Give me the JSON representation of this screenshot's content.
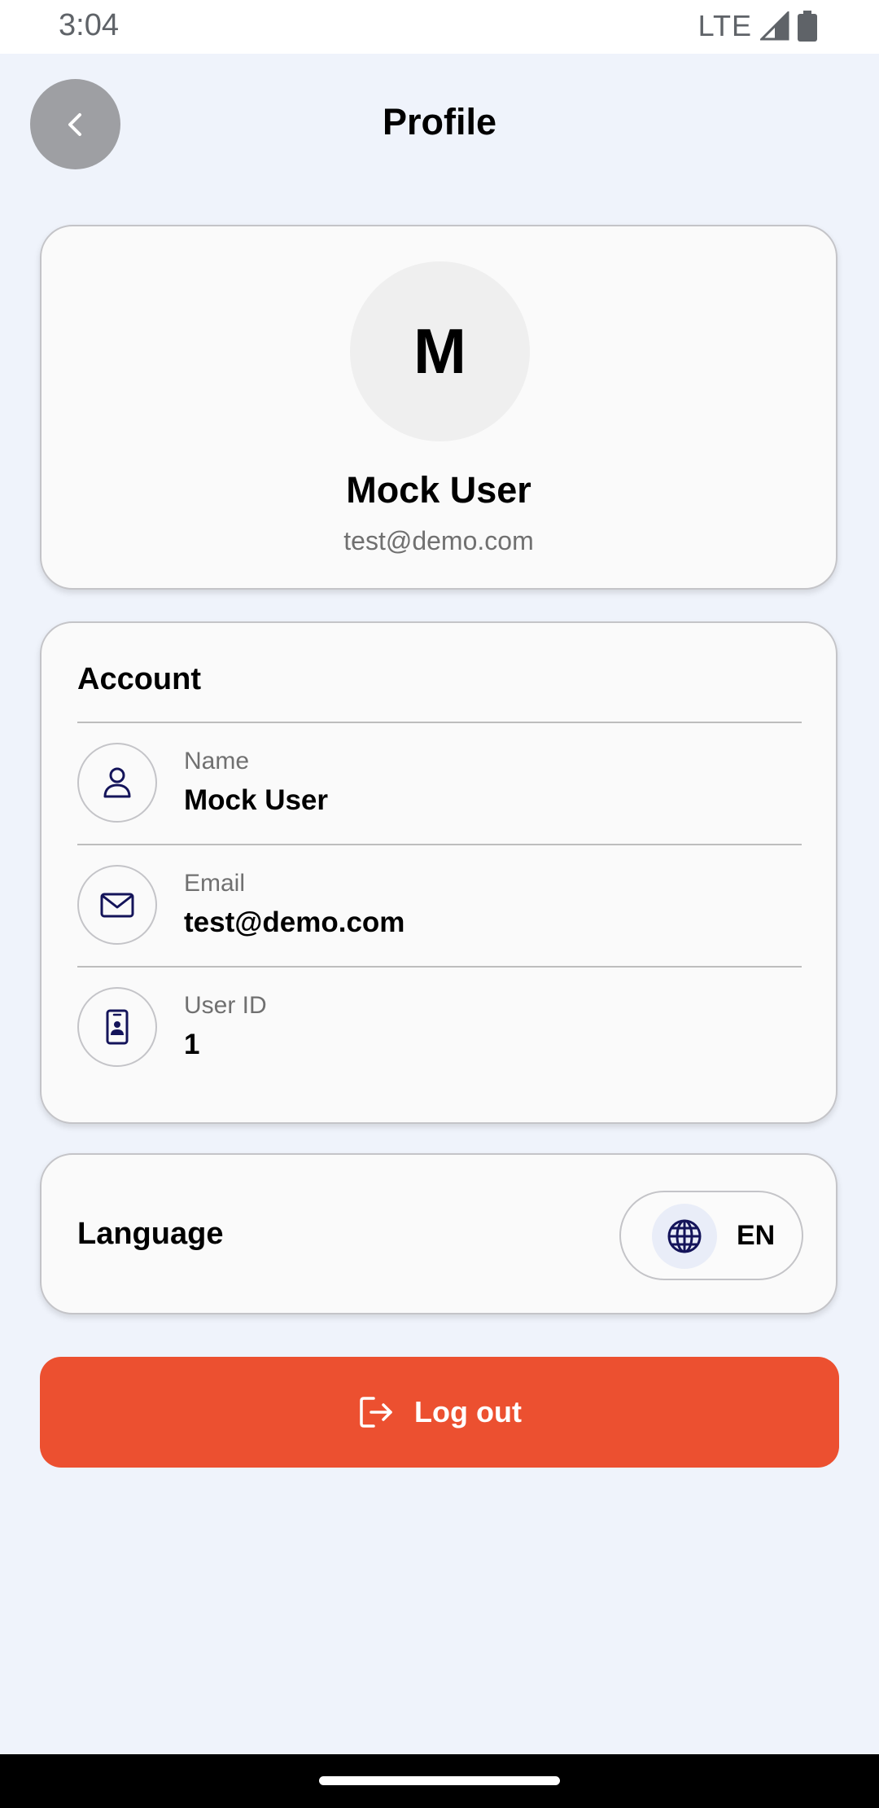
{
  "status_bar": {
    "time": "3:04",
    "network": "LTE",
    "icons": [
      "signal-icon",
      "battery-icon"
    ]
  },
  "header": {
    "title": "Profile",
    "back_icon": "chevron-left-icon"
  },
  "profile": {
    "avatar_initial": "M",
    "name": "Mock User",
    "email": "test@demo.com"
  },
  "account": {
    "title": "Account",
    "rows": [
      {
        "icon": "user-icon",
        "label": "Name",
        "value": "Mock User"
      },
      {
        "icon": "mail-icon",
        "label": "Email",
        "value": "test@demo.com"
      },
      {
        "icon": "id-badge-icon",
        "label": "User ID",
        "value": "1"
      }
    ]
  },
  "language": {
    "label": "Language",
    "current": "EN",
    "icon": "globe-icon"
  },
  "logout": {
    "label": "Log out",
    "icon": "logout-icon"
  },
  "colors": {
    "background": "#eff3fb",
    "accent_icon": "#14145a",
    "logout": "#ec5030",
    "back_button": "#9e9fa3"
  }
}
